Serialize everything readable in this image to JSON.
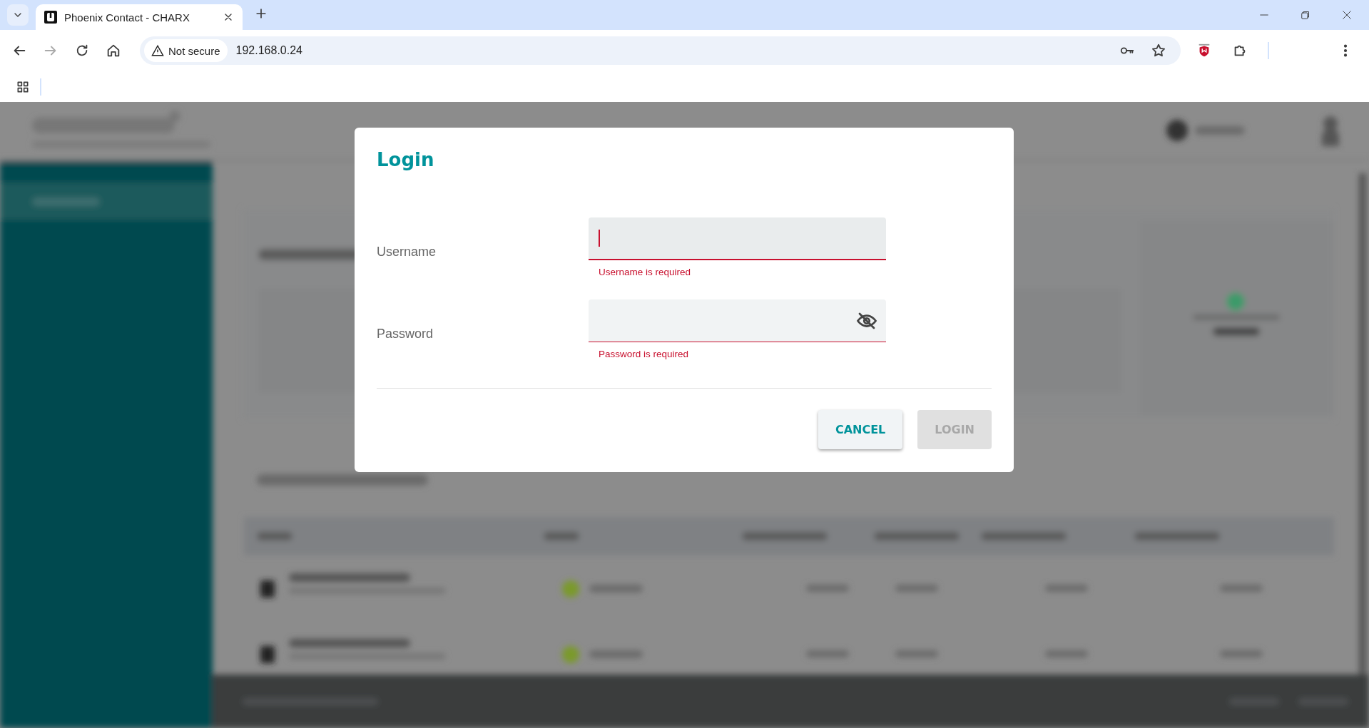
{
  "browser": {
    "tab": {
      "title": "Phoenix Contact - CHARX",
      "selected": true
    },
    "address": {
      "security": "Not secure",
      "url": "192.168.0.24"
    }
  },
  "dialog": {
    "title": "Login",
    "fields": [
      {
        "label": "Username",
        "kind": "text",
        "focused": true,
        "error": "Username is required"
      },
      {
        "label": "Password",
        "kind": "password",
        "focused": false,
        "error": "Password is required"
      }
    ],
    "buttons": [
      {
        "label": "CANCEL",
        "disabled": false
      },
      {
        "label": "LOGIN",
        "disabled": true
      }
    ]
  }
}
